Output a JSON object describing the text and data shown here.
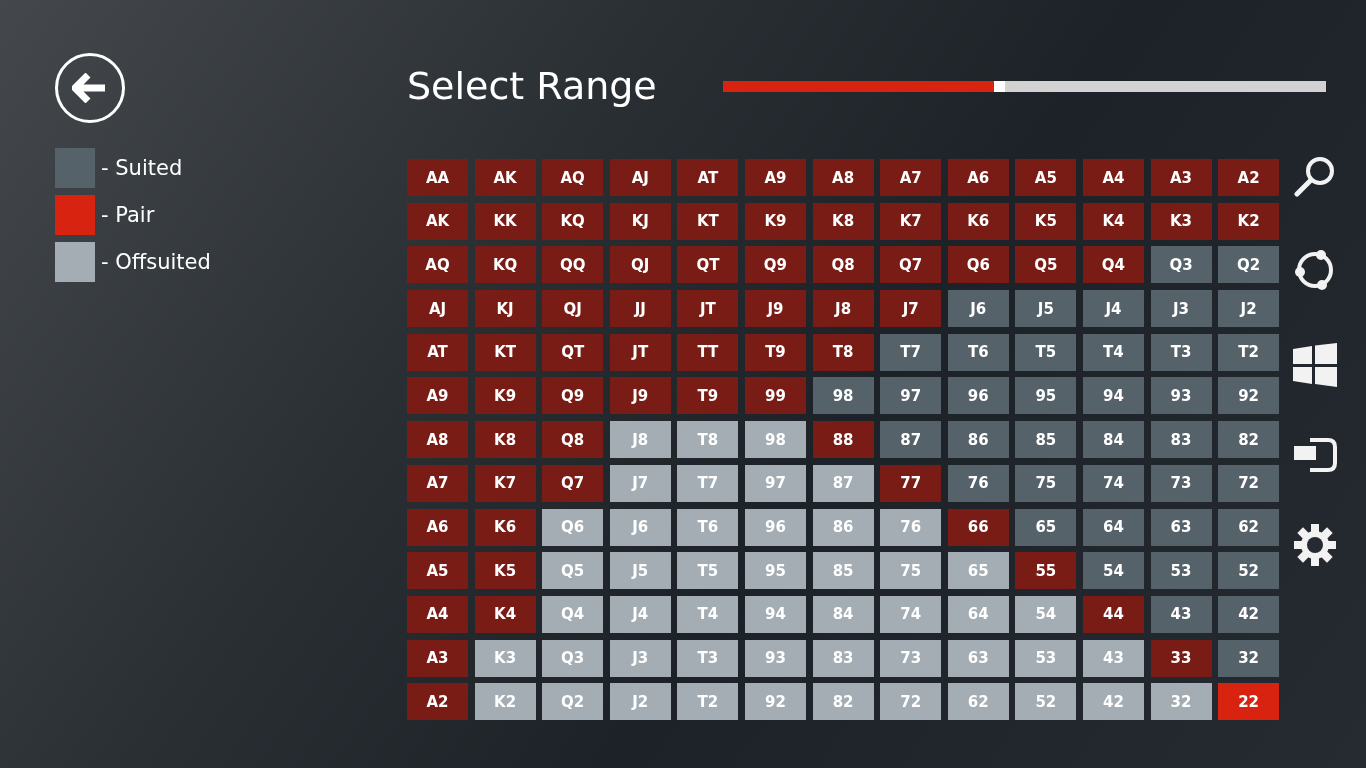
{
  "title": "Select Range",
  "progress": {
    "level": 0.45
  },
  "legend": [
    {
      "label": "- Suited",
      "color": "#56626a"
    },
    {
      "label": "- Pair",
      "color": "#d7230f"
    },
    {
      "label": "- Offsuited",
      "color": "#a3adb3"
    }
  ],
  "grid": [
    {
      "cells": [
        {
          "label": "AA",
          "selected": true
        },
        {
          "label": "AK",
          "selected": true
        },
        {
          "label": "AQ",
          "selected": true
        },
        {
          "label": "AJ",
          "selected": true
        },
        {
          "label": "AT",
          "selected": true
        },
        {
          "label": "A9",
          "selected": true
        },
        {
          "label": "A8",
          "selected": true
        },
        {
          "label": "A7",
          "selected": true
        },
        {
          "label": "A6",
          "selected": true
        },
        {
          "label": "A5",
          "selected": true
        },
        {
          "label": "A4",
          "selected": true
        },
        {
          "label": "A3",
          "selected": true
        },
        {
          "label": "A2",
          "selected": true
        }
      ]
    },
    {
      "cells": [
        {
          "label": "AK",
          "selected": true
        },
        {
          "label": "KK",
          "selected": true
        },
        {
          "label": "KQ",
          "selected": true
        },
        {
          "label": "KJ",
          "selected": true
        },
        {
          "label": "KT",
          "selected": true
        },
        {
          "label": "K9",
          "selected": true
        },
        {
          "label": "K8",
          "selected": true
        },
        {
          "label": "K7",
          "selected": true
        },
        {
          "label": "K6",
          "selected": true
        },
        {
          "label": "K5",
          "selected": true
        },
        {
          "label": "K4",
          "selected": true
        },
        {
          "label": "K3",
          "selected": true
        },
        {
          "label": "K2",
          "selected": true
        }
      ]
    },
    {
      "cells": [
        {
          "label": "AQ",
          "selected": true
        },
        {
          "label": "KQ",
          "selected": true
        },
        {
          "label": "QQ",
          "selected": true
        },
        {
          "label": "QJ",
          "selected": true
        },
        {
          "label": "QT",
          "selected": true
        },
        {
          "label": "Q9",
          "selected": true
        },
        {
          "label": "Q8",
          "selected": true
        },
        {
          "label": "Q7",
          "selected": true
        },
        {
          "label": "Q6",
          "selected": true
        },
        {
          "label": "Q5",
          "selected": true
        },
        {
          "label": "Q4",
          "selected": true
        },
        {
          "label": "Q3",
          "kind": "suited",
          "selected": false
        },
        {
          "label": "Q2",
          "kind": "suited",
          "selected": false
        }
      ]
    },
    {
      "cells": [
        {
          "label": "AJ",
          "selected": true
        },
        {
          "label": "KJ",
          "selected": true
        },
        {
          "label": "QJ",
          "selected": true
        },
        {
          "label": "JJ",
          "selected": true
        },
        {
          "label": "JT",
          "selected": true
        },
        {
          "label": "J9",
          "selected": true
        },
        {
          "label": "J8",
          "selected": true
        },
        {
          "label": "J7",
          "selected": true
        },
        {
          "label": "J6",
          "kind": "suited",
          "selected": false
        },
        {
          "label": "J5",
          "kind": "suited",
          "selected": false
        },
        {
          "label": "J4",
          "kind": "suited",
          "selected": false
        },
        {
          "label": "J3",
          "kind": "suited",
          "selected": false
        },
        {
          "label": "J2",
          "kind": "suited",
          "selected": false
        }
      ]
    },
    {
      "cells": [
        {
          "label": "AT",
          "selected": true
        },
        {
          "label": "KT",
          "selected": true
        },
        {
          "label": "QT",
          "selected": true
        },
        {
          "label": "JT",
          "selected": true
        },
        {
          "label": "TT",
          "selected": true
        },
        {
          "label": "T9",
          "selected": true
        },
        {
          "label": "T8",
          "selected": true
        },
        {
          "label": "T7",
          "kind": "suited",
          "selected": false
        },
        {
          "label": "T6",
          "kind": "suited",
          "selected": false
        },
        {
          "label": "T5",
          "kind": "suited",
          "selected": false
        },
        {
          "label": "T4",
          "kind": "suited",
          "selected": false
        },
        {
          "label": "T3",
          "kind": "suited",
          "selected": false
        },
        {
          "label": "T2",
          "kind": "suited",
          "selected": false
        }
      ]
    },
    {
      "cells": [
        {
          "label": "A9",
          "selected": true
        },
        {
          "label": "K9",
          "selected": true
        },
        {
          "label": "Q9",
          "selected": true
        },
        {
          "label": "J9",
          "selected": true
        },
        {
          "label": "T9",
          "selected": true
        },
        {
          "label": "99",
          "selected": true
        },
        {
          "label": "98",
          "kind": "suited",
          "selected": false
        },
        {
          "label": "97",
          "kind": "suited",
          "selected": false
        },
        {
          "label": "96",
          "kind": "suited",
          "selected": false
        },
        {
          "label": "95",
          "kind": "suited",
          "selected": false
        },
        {
          "label": "94",
          "kind": "suited",
          "selected": false
        },
        {
          "label": "93",
          "kind": "suited",
          "selected": false
        },
        {
          "label": "92",
          "kind": "suited",
          "selected": false
        }
      ]
    },
    {
      "cells": [
        {
          "label": "A8",
          "selected": true
        },
        {
          "label": "K8",
          "selected": true
        },
        {
          "label": "Q8",
          "selected": true
        },
        {
          "label": "J8",
          "kind": "offsuit",
          "selected": false
        },
        {
          "label": "T8",
          "kind": "offsuit",
          "selected": false
        },
        {
          "label": "98",
          "kind": "offsuit",
          "selected": false
        },
        {
          "label": "88",
          "selected": true
        },
        {
          "label": "87",
          "kind": "suited",
          "selected": false
        },
        {
          "label": "86",
          "kind": "suited",
          "selected": false
        },
        {
          "label": "85",
          "kind": "suited",
          "selected": false
        },
        {
          "label": "84",
          "kind": "suited",
          "selected": false
        },
        {
          "label": "83",
          "kind": "suited",
          "selected": false
        },
        {
          "label": "82",
          "kind": "suited",
          "selected": false
        }
      ]
    },
    {
      "cells": [
        {
          "label": "A7",
          "selected": true
        },
        {
          "label": "K7",
          "selected": true
        },
        {
          "label": "Q7",
          "selected": true
        },
        {
          "label": "J7",
          "kind": "offsuit",
          "selected": false
        },
        {
          "label": "T7",
          "kind": "offsuit",
          "selected": false
        },
        {
          "label": "97",
          "kind": "offsuit",
          "selected": false
        },
        {
          "label": "87",
          "kind": "offsuit",
          "selected": false
        },
        {
          "label": "77",
          "selected": true
        },
        {
          "label": "76",
          "kind": "suited",
          "selected": false
        },
        {
          "label": "75",
          "kind": "suited",
          "selected": false
        },
        {
          "label": "74",
          "kind": "suited",
          "selected": false
        },
        {
          "label": "73",
          "kind": "suited",
          "selected": false
        },
        {
          "label": "72",
          "kind": "suited",
          "selected": false
        }
      ]
    },
    {
      "cells": [
        {
          "label": "A6",
          "selected": true
        },
        {
          "label": "K6",
          "selected": true
        },
        {
          "label": "Q6",
          "kind": "offsuit",
          "selected": false
        },
        {
          "label": "J6",
          "kind": "offsuit",
          "selected": false
        },
        {
          "label": "T6",
          "kind": "offsuit",
          "selected": false
        },
        {
          "label": "96",
          "kind": "offsuit",
          "selected": false
        },
        {
          "label": "86",
          "kind": "offsuit",
          "selected": false
        },
        {
          "label": "76",
          "kind": "offsuit",
          "selected": false
        },
        {
          "label": "66",
          "selected": true
        },
        {
          "label": "65",
          "kind": "suited",
          "selected": false
        },
        {
          "label": "64",
          "kind": "suited",
          "selected": false
        },
        {
          "label": "63",
          "kind": "suited",
          "selected": false
        },
        {
          "label": "62",
          "kind": "suited",
          "selected": false
        }
      ]
    },
    {
      "cells": [
        {
          "label": "A5",
          "selected": true
        },
        {
          "label": "K5",
          "selected": true
        },
        {
          "label": "Q5",
          "kind": "offsuit",
          "selected": false
        },
        {
          "label": "J5",
          "kind": "offsuit",
          "selected": false
        },
        {
          "label": "T5",
          "kind": "offsuit",
          "selected": false
        },
        {
          "label": "95",
          "kind": "offsuit",
          "selected": false
        },
        {
          "label": "85",
          "kind": "offsuit",
          "selected": false
        },
        {
          "label": "75",
          "kind": "offsuit",
          "selected": false
        },
        {
          "label": "65",
          "kind": "offsuit",
          "selected": false
        },
        {
          "label": "55",
          "selected": true
        },
        {
          "label": "54",
          "kind": "suited",
          "selected": false
        },
        {
          "label": "53",
          "kind": "suited",
          "selected": false
        },
        {
          "label": "52",
          "kind": "suited",
          "selected": false
        }
      ]
    },
    {
      "cells": [
        {
          "label": "A4",
          "selected": true
        },
        {
          "label": "K4",
          "selected": true
        },
        {
          "label": "Q4",
          "kind": "offsuit",
          "selected": false
        },
        {
          "label": "J4",
          "kind": "offsuit",
          "selected": false
        },
        {
          "label": "T4",
          "kind": "offsuit",
          "selected": false
        },
        {
          "label": "94",
          "kind": "offsuit",
          "selected": false
        },
        {
          "label": "84",
          "kind": "offsuit",
          "selected": false
        },
        {
          "label": "74",
          "kind": "offsuit",
          "selected": false
        },
        {
          "label": "64",
          "kind": "offsuit",
          "selected": false
        },
        {
          "label": "54",
          "kind": "offsuit",
          "selected": false
        },
        {
          "label": "44",
          "selected": true
        },
        {
          "label": "43",
          "kind": "suited",
          "selected": false
        },
        {
          "label": "42",
          "kind": "suited",
          "selected": false
        }
      ]
    },
    {
      "cells": [
        {
          "label": "A3",
          "selected": true
        },
        {
          "label": "K3",
          "kind": "offsuit",
          "selected": false
        },
        {
          "label": "Q3",
          "kind": "offsuit",
          "selected": false
        },
        {
          "label": "J3",
          "kind": "offsuit",
          "selected": false
        },
        {
          "label": "T3",
          "kind": "offsuit",
          "selected": false
        },
        {
          "label": "93",
          "kind": "offsuit",
          "selected": false
        },
        {
          "label": "83",
          "kind": "offsuit",
          "selected": false
        },
        {
          "label": "73",
          "kind": "offsuit",
          "selected": false
        },
        {
          "label": "63",
          "kind": "offsuit",
          "selected": false
        },
        {
          "label": "53",
          "kind": "offsuit",
          "selected": false
        },
        {
          "label": "43",
          "kind": "offsuit",
          "selected": false
        },
        {
          "label": "33",
          "selected": true
        },
        {
          "label": "32",
          "kind": "suited",
          "selected": false
        }
      ]
    },
    {
      "cells": [
        {
          "label": "A2",
          "selected": true
        },
        {
          "label": "K2",
          "kind": "offsuit",
          "selected": false
        },
        {
          "label": "Q2",
          "kind": "offsuit",
          "selected": false
        },
        {
          "label": "J2",
          "kind": "offsuit",
          "selected": false
        },
        {
          "label": "T2",
          "kind": "offsuit",
          "selected": false
        },
        {
          "label": "92",
          "kind": "offsuit",
          "selected": false
        },
        {
          "label": "82",
          "kind": "offsuit",
          "selected": false
        },
        {
          "label": "72",
          "kind": "offsuit",
          "selected": false
        },
        {
          "label": "62",
          "kind": "offsuit",
          "selected": false
        },
        {
          "label": "52",
          "kind": "offsuit",
          "selected": false
        },
        {
          "label": "42",
          "kind": "offsuit",
          "selected": false
        },
        {
          "label": "32",
          "kind": "offsuit",
          "selected": false
        },
        {
          "label": "22",
          "kind": "pair",
          "selected": false
        }
      ]
    }
  ]
}
